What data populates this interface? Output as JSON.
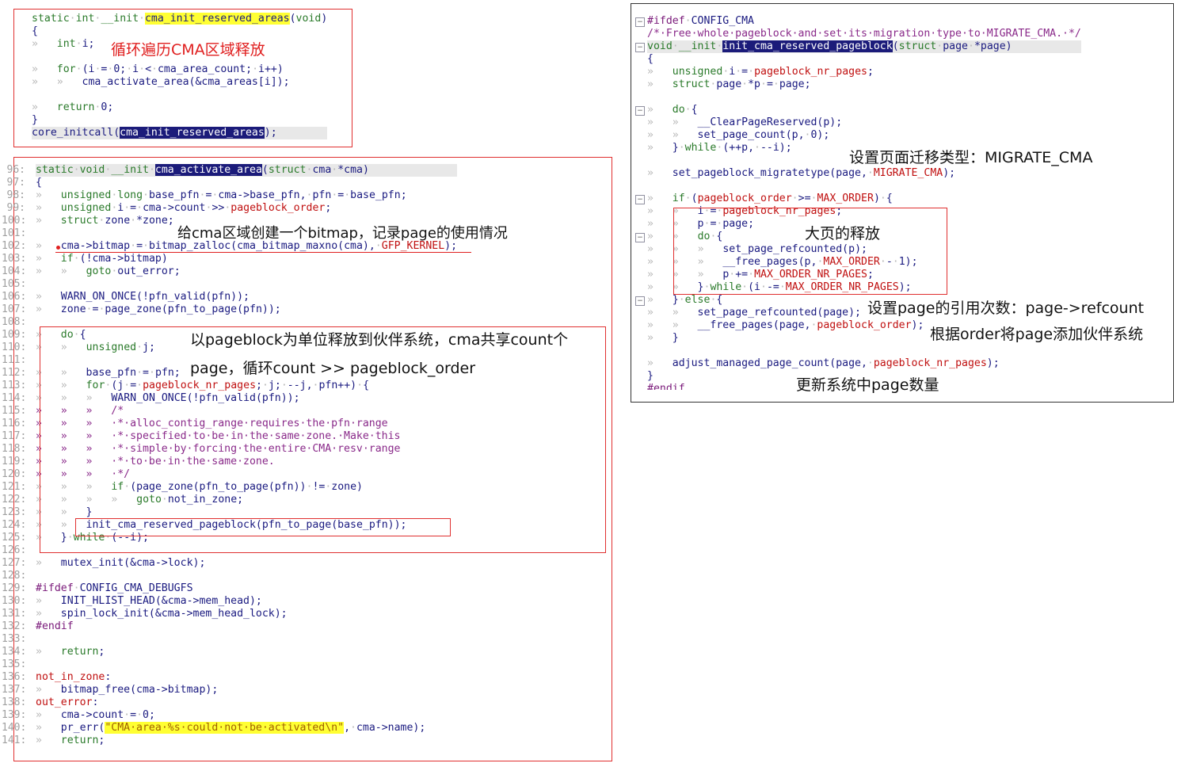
{
  "panel1": {
    "lines": [
      "static·int·__init·cma_init_reserved_areas(void)",
      "{",
      "»   int·i;",
      "",
      "»   for·(i·=·0;·i·<·cma_area_count;·i++)",
      "»   »   cma_activate_area(&cma_areas[i]);",
      "",
      "»   return·0;",
      "}",
      "core_initcall(cma_init_reserved_areas);"
    ],
    "note": "循环遍历CMA区域释放"
  },
  "panel2": {
    "line_numbers": [
      "96:",
      "97:",
      "98:",
      "99:",
      "100:",
      "101:",
      "102:",
      "103:",
      "104:",
      "105:",
      "106:",
      "107:",
      "108:",
      "109:",
      "110:",
      "111:",
      "112:",
      "113:",
      "114:",
      "115:",
      "116:",
      "117:",
      "118:",
      "119:",
      "120:",
      "121:",
      "122:",
      "123:",
      "124:",
      "125:",
      "126:",
      "127:",
      "128:",
      "129:",
      "130:",
      "131:",
      "132:",
      "133:",
      "134:",
      "135:",
      "136:",
      "137:",
      "138:",
      "139:",
      "140:",
      "141:"
    ],
    "lines": [
      "static·void·__init·cma_activate_area(struct·cma·*cma)",
      "{",
      "»   unsigned·long·base_pfn·=·cma->base_pfn,·pfn·=·base_pfn;",
      "»   unsigned·i·=·cma->count·>>·pageblock_order;",
      "»   struct·zone·*zone;",
      "",
      "»   cma->bitmap·=·bitmap_zalloc(cma_bitmap_maxno(cma),·GFP_KERNEL);",
      "»   if·(!cma->bitmap)",
      "»   »   goto·out_error;",
      "",
      "»   WARN_ON_ONCE(!pfn_valid(pfn));",
      "»   zone·=·page_zone(pfn_to_page(pfn));",
      "",
      "»   do·{",
      "»   »   unsigned·j;",
      "",
      "»   »   base_pfn·=·pfn;",
      "»   »   for·(j·=·pageblock_nr_pages;·j;·--j,·pfn++)·{",
      "»   »   »   WARN_ON_ONCE(!pfn_valid(pfn));",
      "»   »   »   /*",
      "»   »   »   ·*·alloc_contig_range·requires·the·pfn·range",
      "»   »   »   ·*·specified·to·be·in·the·same·zone.·Make·this",
      "»   »   »   ·*·simple·by·forcing·the·entire·CMA·resv·range",
      "»   »   »   ·*·to·be·in·the·same·zone.",
      "»   »   »   ·*/",
      "»   »   »   if·(page_zone(pfn_to_page(pfn))·!=·zone)",
      "»   »   »   »   goto·not_in_zone;",
      "»   »   }",
      "»   »   init_cma_reserved_pageblock(pfn_to_page(base_pfn));",
      "»   }·while·(--i);",
      "",
      "»   mutex_init(&cma->lock);",
      "",
      "#ifdef·CONFIG_CMA_DEBUGFS",
      "»   INIT_HLIST_HEAD(&cma->mem_head);",
      "»   spin_lock_init(&cma->mem_head_lock);",
      "#endif",
      "",
      "»   return;",
      "",
      "not_in_zone:",
      "»   bitmap_free(cma->bitmap);",
      "out_error:",
      "»   cma->count·=·0;",
      "»   pr_err(\"CMA·area·%s·could·not·be·activated\\n\",·cma->name);",
      "»   return;"
    ],
    "note_bitmap": "给cma区域创建一个bitmap，记录page的使用情况",
    "note_pageblock_1": "以pageblock为单位释放到伙伴系统，cma共享count个",
    "note_pageblock_2": "page，循环count >> pageblock_order"
  },
  "panel3": {
    "lines": [
      "#ifdef·CONFIG_CMA",
      "/*·Free·whole·pageblock·and·set·its·migration·type·to·MIGRATE_CMA.·*/",
      "void·__init·init_cma_reserved_pageblock(struct·page·*page)",
      "{",
      "»   unsigned·i·=·pageblock_nr_pages;",
      "»   struct·page·*p·=·page;",
      "",
      "»   do·{",
      "»   »   __ClearPageReserved(p);",
      "»   »   set_page_count(p,·0);",
      "»   }·while·(++p,·--i);",
      "",
      "»   set_pageblock_migratetype(page,·MIGRATE_CMA);",
      "",
      "»   if·(pageblock_order·>=·MAX_ORDER)·{",
      "»   »   i·=·pageblock_nr_pages;",
      "»   »   p·=·page;",
      "»   »   do·{",
      "»   »   »   set_page_refcounted(p);",
      "»   »   »   __free_pages(p,·MAX_ORDER·-·1);",
      "»   »   »   p·+=·MAX_ORDER_NR_PAGES;",
      "»   »   }·while·(i·-=·MAX_ORDER_NR_PAGES);",
      "»   }·else·{",
      "»   »   set_page_refcounted(page);",
      "»   »   __free_pages(page,·pageblock_order);",
      "»   }",
      "",
      "»   adjust_managed_page_count(page,·pageblock_nr_pages);",
      "}",
      "#endif"
    ],
    "note_migrate": "设置页面迁移类型：MIGRATE_CMA",
    "note_bigpage": "大页的释放",
    "note_refcount": "设置page的引用次数：page->refcount",
    "note_order": "根据order将page添加伙伴系统",
    "note_update": "更新系统中page数量",
    "fold_icons": [
      "minus-icon",
      "minus-icon",
      "minus-icon",
      "minus-icon",
      "minus-icon",
      "minus-icon",
      "minus-icon",
      "minus-icon"
    ]
  },
  "colors": {
    "annotation_red": "#e02020",
    "keyword_green": "#2a7a2a",
    "macro_red": "#c01010",
    "identifier_blue": "#1a1a80",
    "selection_navy": "#1b1b7a",
    "search_yellow": "#ffff33"
  }
}
